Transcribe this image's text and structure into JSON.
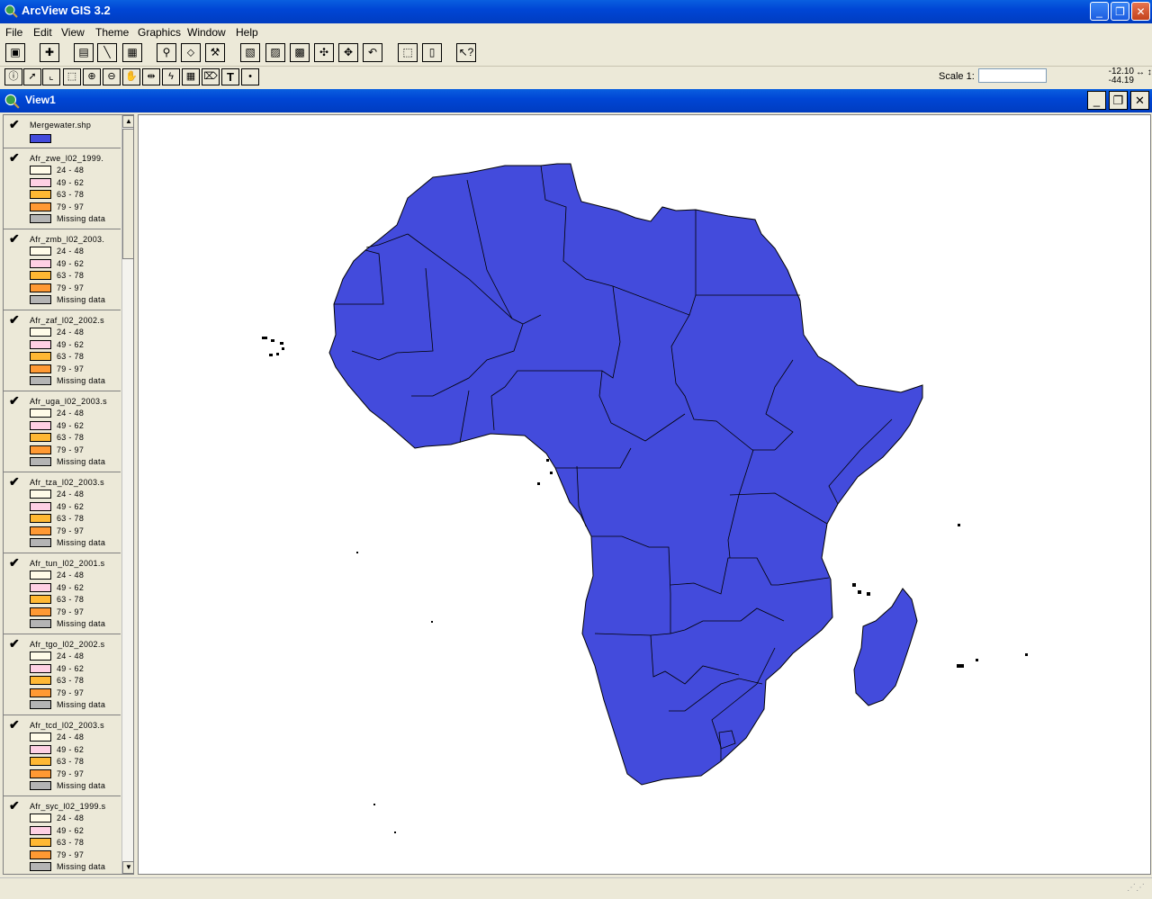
{
  "app": {
    "title": "ArcView GIS 3.2",
    "window_buttons": {
      "minimize": "_",
      "restore": "❐",
      "close": "✕"
    }
  },
  "menu": [
    "File",
    "Edit",
    "View",
    "Theme",
    "Graphics",
    "Window",
    "Help"
  ],
  "toolbar1": [
    "save-icon",
    "add-theme-icon",
    "theme-properties-icon",
    "edit-legend-icon",
    "open-table-icon",
    "find-icon",
    "locate-address-icon",
    "query-builder-icon",
    "zoom-full-icon",
    "zoom-active-icon",
    "zoom-selected-icon",
    "zoom-in-fixed-icon",
    "zoom-out-fixed-icon",
    "zoom-previous-icon",
    "select-by-theme-icon",
    "clear-selection-icon",
    "help-icon"
  ],
  "toolbar2": {
    "tools": [
      "identify-icon",
      "pointer-icon",
      "vertex-edit-icon",
      "select-feature-icon",
      "zoom-in-icon",
      "zoom-out-icon",
      "pan-icon",
      "measure-icon",
      "hotlink-icon",
      "area-of-interest-icon",
      "label-icon",
      "text-icon",
      "draw-point-icon"
    ],
    "scale_label": "Scale 1:",
    "scale_value": "",
    "coord_x": "-12.10",
    "coord_y": "-44.19",
    "coord_arrows": "↔ ↕"
  },
  "view": {
    "title": "View1",
    "buttons": {
      "minimize": "_",
      "restore": "❐",
      "close": "✕"
    }
  },
  "colors": {
    "land": "#434bdc",
    "class1": "#fffbe8",
    "class2": "#ffd0e4",
    "class3": "#ffb833",
    "class4": "#ff9933",
    "missing": "#b4b4b4"
  },
  "legend": {
    "first_theme": {
      "name": "Mergewater.shp",
      "checked": "✔"
    },
    "themes": [
      {
        "name": "Afr_zwe_l02_1999.",
        "checked": "✔"
      },
      {
        "name": "Afr_zmb_l02_2003.",
        "checked": "✔"
      },
      {
        "name": "Afr_zaf_l02_2002.s",
        "checked": "✔"
      },
      {
        "name": "Afr_uga_l02_2003.s",
        "checked": "✔"
      },
      {
        "name": "Afr_tza_l02_2003.s",
        "checked": "✔"
      },
      {
        "name": "Afr_tun_l02_2001.s",
        "checked": "✔"
      },
      {
        "name": "Afr_tgo_l02_2002.s",
        "checked": "✔"
      },
      {
        "name": "Afr_tcd_l02_2003.s",
        "checked": "✔"
      },
      {
        "name": "Afr_syc_l02_1999.s",
        "checked": "✔"
      }
    ],
    "classes": [
      "24 - 48",
      "49 - 62",
      "63 - 78",
      "79 - 97",
      "Missing data"
    ]
  }
}
